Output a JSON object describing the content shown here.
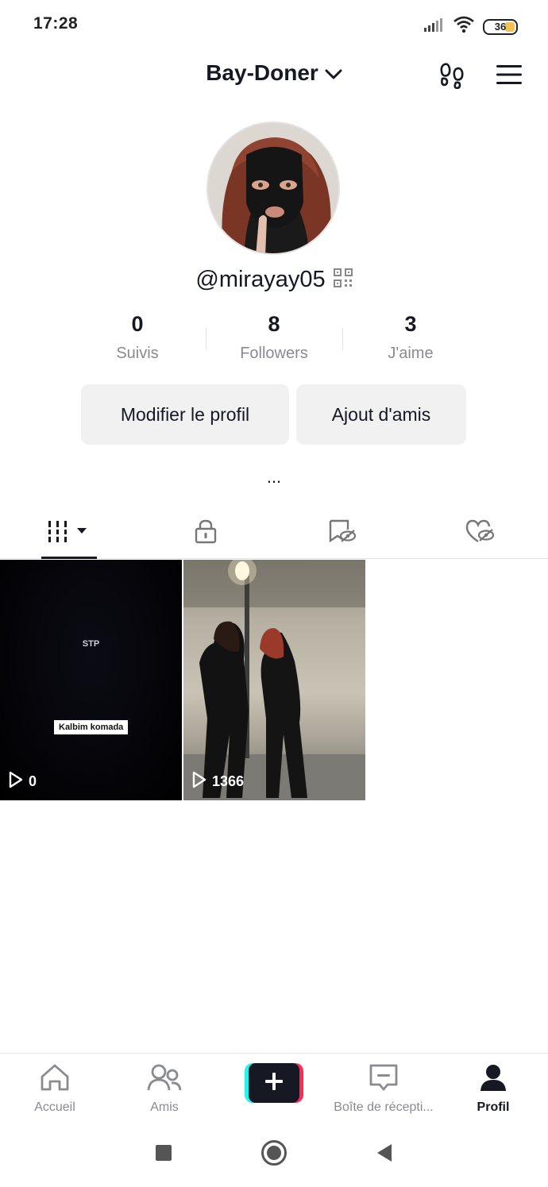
{
  "status_bar": {
    "time": "17:28",
    "battery": "36",
    "signal_icon": "signal-icon",
    "wifi_icon": "wifi-icon"
  },
  "header": {
    "account_name": "Bay-Doner",
    "dropdown_icon": "chevron-down-icon",
    "footprint_icon": "footprint-icon",
    "menu_icon": "hamburger-menu-icon"
  },
  "profile": {
    "handle": "@mirayay05",
    "qr_icon": "qr-code-icon",
    "stats": [
      {
        "value": "0",
        "label": "Suivis"
      },
      {
        "value": "8",
        "label": "Followers"
      },
      {
        "value": "3",
        "label": "J'aime"
      }
    ],
    "edit_button": "Modifier le profil",
    "add_friends_button": "Ajout d'amis",
    "bio": "..."
  },
  "tabs": [
    {
      "name": "videos",
      "icon": "grid-icon",
      "active": true
    },
    {
      "name": "private",
      "icon": "lock-icon",
      "active": false
    },
    {
      "name": "reposts",
      "icon": "repost-hidden-icon",
      "active": false
    },
    {
      "name": "liked",
      "icon": "heart-hidden-icon",
      "active": false
    }
  ],
  "videos": [
    {
      "overlay_top": "STP",
      "caption": "Kalbim komada",
      "views": "0"
    },
    {
      "views": "1366"
    }
  ],
  "bottom_nav": [
    {
      "label": "Accueil",
      "icon": "home-icon"
    },
    {
      "label": "Amis",
      "icon": "friends-icon"
    },
    {
      "label": "",
      "icon": "plus-icon"
    },
    {
      "label": "Boîte de récepti...",
      "icon": "inbox-icon"
    },
    {
      "label": "Profil",
      "icon": "profile-icon",
      "active": true
    }
  ],
  "colors": {
    "accent_cyan": "#25f4ee",
    "accent_red": "#fe2c55",
    "text_primary": "#161823",
    "text_secondary": "#8a8b91"
  }
}
